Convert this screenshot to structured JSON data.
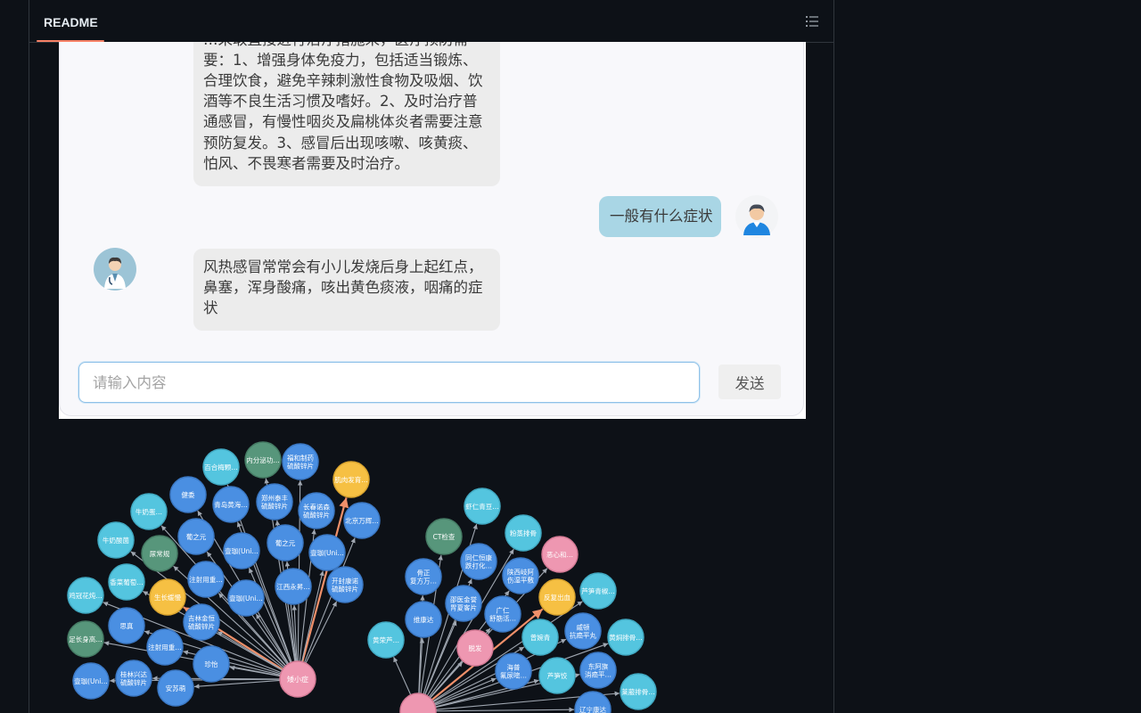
{
  "header": {
    "tab_label": "README",
    "outline_icon": "list-unordered-icon"
  },
  "chat": {
    "previous_bot_message": "…采取直接进行治疗措施来，医疗预防需要：1、增强身体免疫力，包括适当锻炼、合理饮食，避免辛辣刺激性食物及吸烟、饮酒等不良生活习惯及嗜好。2、及时治疗普通感冒，有慢性咽炎及扁桃体炎者需要注意预防复发。3、感冒后出现咳嗽、咳黄痰、怕风、不畏寒者需要及时治疗。",
    "user_message": "一般有什么症状",
    "bot_answer": "风热感冒常常会有小儿发烧后身上起红点，鼻塞，浑身酸痛，咳出黄色痰液，咽痛的症状",
    "input_placeholder": "请输入内容",
    "input_value": "",
    "send_label": "发送"
  },
  "colors": {
    "page_bg": "#0d1117",
    "tab_underline": "#f78166",
    "user_bubble": "#a9d6e5",
    "bot_bubble": "#ececec",
    "node_blue": "#4a8fe2",
    "node_cyan": "#54c5df",
    "node_green": "#57967b",
    "node_pink": "#ee97b1",
    "node_yellow": "#f6c043"
  },
  "graph": {
    "clusters": [
      {
        "center": "矮小症",
        "nodes": [
          {
            "label": "百合梅颗…",
            "kind": "cyan"
          },
          {
            "label": "内分泌功…",
            "kind": "green"
          },
          {
            "label": "福和制药 硫酸锌片",
            "kind": "blue"
          },
          {
            "label": "肌肉发育…",
            "kind": "yellow"
          },
          {
            "label": "健委",
            "kind": "blue"
          },
          {
            "label": "青岛黄海…",
            "kind": "blue"
          },
          {
            "label": "郑州泰丰 硫酸锌片",
            "kind": "blue"
          },
          {
            "label": "长春诺森 硫酸锌片",
            "kind": "blue"
          },
          {
            "label": "北京万辉…",
            "kind": "blue"
          },
          {
            "label": "牛奶蛋…",
            "kind": "cyan"
          },
          {
            "label": "葡之元",
            "kind": "blue"
          },
          {
            "label": "壹珈(Uni…",
            "kind": "blue"
          },
          {
            "label": "葡之元",
            "kind": "blue"
          },
          {
            "label": "壹珈(Uni…",
            "kind": "blue"
          },
          {
            "label": "牛奶酸菌",
            "kind": "cyan"
          },
          {
            "label": "尿常规",
            "kind": "green"
          },
          {
            "label": "注射用重…",
            "kind": "blue"
          },
          {
            "label": "江西永昇…",
            "kind": "blue"
          },
          {
            "label": "开封康诺 硫酸锌片",
            "kind": "blue"
          },
          {
            "label": "香菜葡萄…",
            "kind": "cyan"
          },
          {
            "label": "生长缓慢",
            "kind": "yellow"
          },
          {
            "label": "壹珈(Uni…",
            "kind": "blue"
          },
          {
            "label": "鸡冠花炖…",
            "kind": "cyan"
          },
          {
            "label": "思真",
            "kind": "blue"
          },
          {
            "label": "吉林金恒 硫酸锌片",
            "kind": "blue"
          },
          {
            "label": "足长身高…",
            "kind": "green"
          },
          {
            "label": "注射用重…",
            "kind": "blue"
          },
          {
            "label": "珍怡",
            "kind": "blue"
          },
          {
            "label": "壹珈(Uni…",
            "kind": "blue"
          },
          {
            "label": "桂林兴达 硫酸锌片",
            "kind": "blue"
          },
          {
            "label": "安苏萌",
            "kind": "blue"
          }
        ]
      },
      {
        "center": "",
        "nodes": [
          {
            "label": "虾仁青豆…",
            "kind": "cyan"
          },
          {
            "label": "CT检查",
            "kind": "green"
          },
          {
            "label": "粉蒸排骨",
            "kind": "cyan"
          },
          {
            "label": "骨正 复方万…",
            "kind": "blue"
          },
          {
            "label": "同仁恒康 跌打化…",
            "kind": "blue"
          },
          {
            "label": "恶心和…",
            "kind": "pink"
          },
          {
            "label": "陕西岐阿 伤湿平敷",
            "kind": "blue"
          },
          {
            "label": "芦笋青椒…",
            "kind": "cyan"
          },
          {
            "label": "维康达",
            "kind": "blue"
          },
          {
            "label": "邵医金誉 胃夏客片",
            "kind": "blue"
          },
          {
            "label": "广仁 舒筋活…",
            "kind": "blue"
          },
          {
            "label": "反复出血",
            "kind": "yellow"
          },
          {
            "label": "黄荣芦…",
            "kind": "cyan"
          },
          {
            "label": "脱发",
            "kind": "pink"
          },
          {
            "label": "曾婉青",
            "kind": "cyan"
          },
          {
            "label": "威顿 抗癌平丸",
            "kind": "blue"
          },
          {
            "label": "黄焖排骨…",
            "kind": "cyan"
          },
          {
            "label": "海普 氟尿嘧…",
            "kind": "blue"
          },
          {
            "label": "芦笋饺",
            "kind": "cyan"
          },
          {
            "label": "东阿旗 消癌平…",
            "kind": "blue"
          },
          {
            "label": "莱菔排骨…",
            "kind": "cyan"
          },
          {
            "label": "辽宁康达",
            "kind": "blue"
          }
        ]
      }
    ]
  }
}
